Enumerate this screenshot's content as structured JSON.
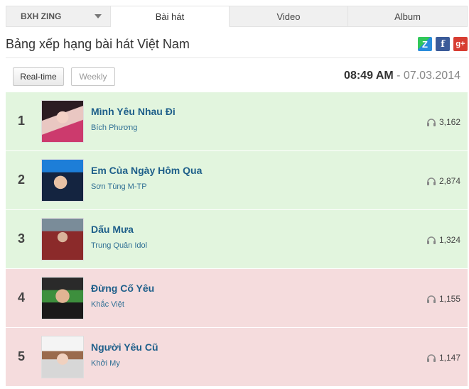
{
  "tabs": {
    "source": "BXH ZING",
    "songs": "Bài hát",
    "video": "Video",
    "album": "Album"
  },
  "header": {
    "title": "Bảng xếp hạng bài hát Việt Nam",
    "share_icons": [
      "zing-icon",
      "facebook-icon",
      "google-plus-icon"
    ]
  },
  "toolbar": {
    "realtime_label": "Real-time",
    "weekly_label": "Weekly",
    "time": "08:49 AM",
    "date": " - 07.03.2014"
  },
  "chart": {
    "rows": [
      {
        "rank": "1",
        "title": "Mình Yêu Nhau Đi",
        "artist": "Bích Phương",
        "plays": "3,162",
        "bg": "#e2f5de"
      },
      {
        "rank": "2",
        "title": "Em Của Ngày Hôm Qua",
        "artist": "Sơn Tùng M-TP",
        "plays": "2,874",
        "bg": "#e2f5de"
      },
      {
        "rank": "3",
        "title": "Dấu Mưa",
        "artist": "Trung Quân Idol",
        "plays": "1,324",
        "bg": "#e2f5de"
      },
      {
        "rank": "4",
        "title": "Đừng Cố Yêu",
        "artist": "Khắc Việt",
        "plays": "1,155",
        "bg": "#f5dcdd"
      },
      {
        "rank": "5",
        "title": "Người Yêu Cũ",
        "artist": "Khởi My",
        "plays": "1,147",
        "bg": "#f5dcdd"
      }
    ]
  }
}
